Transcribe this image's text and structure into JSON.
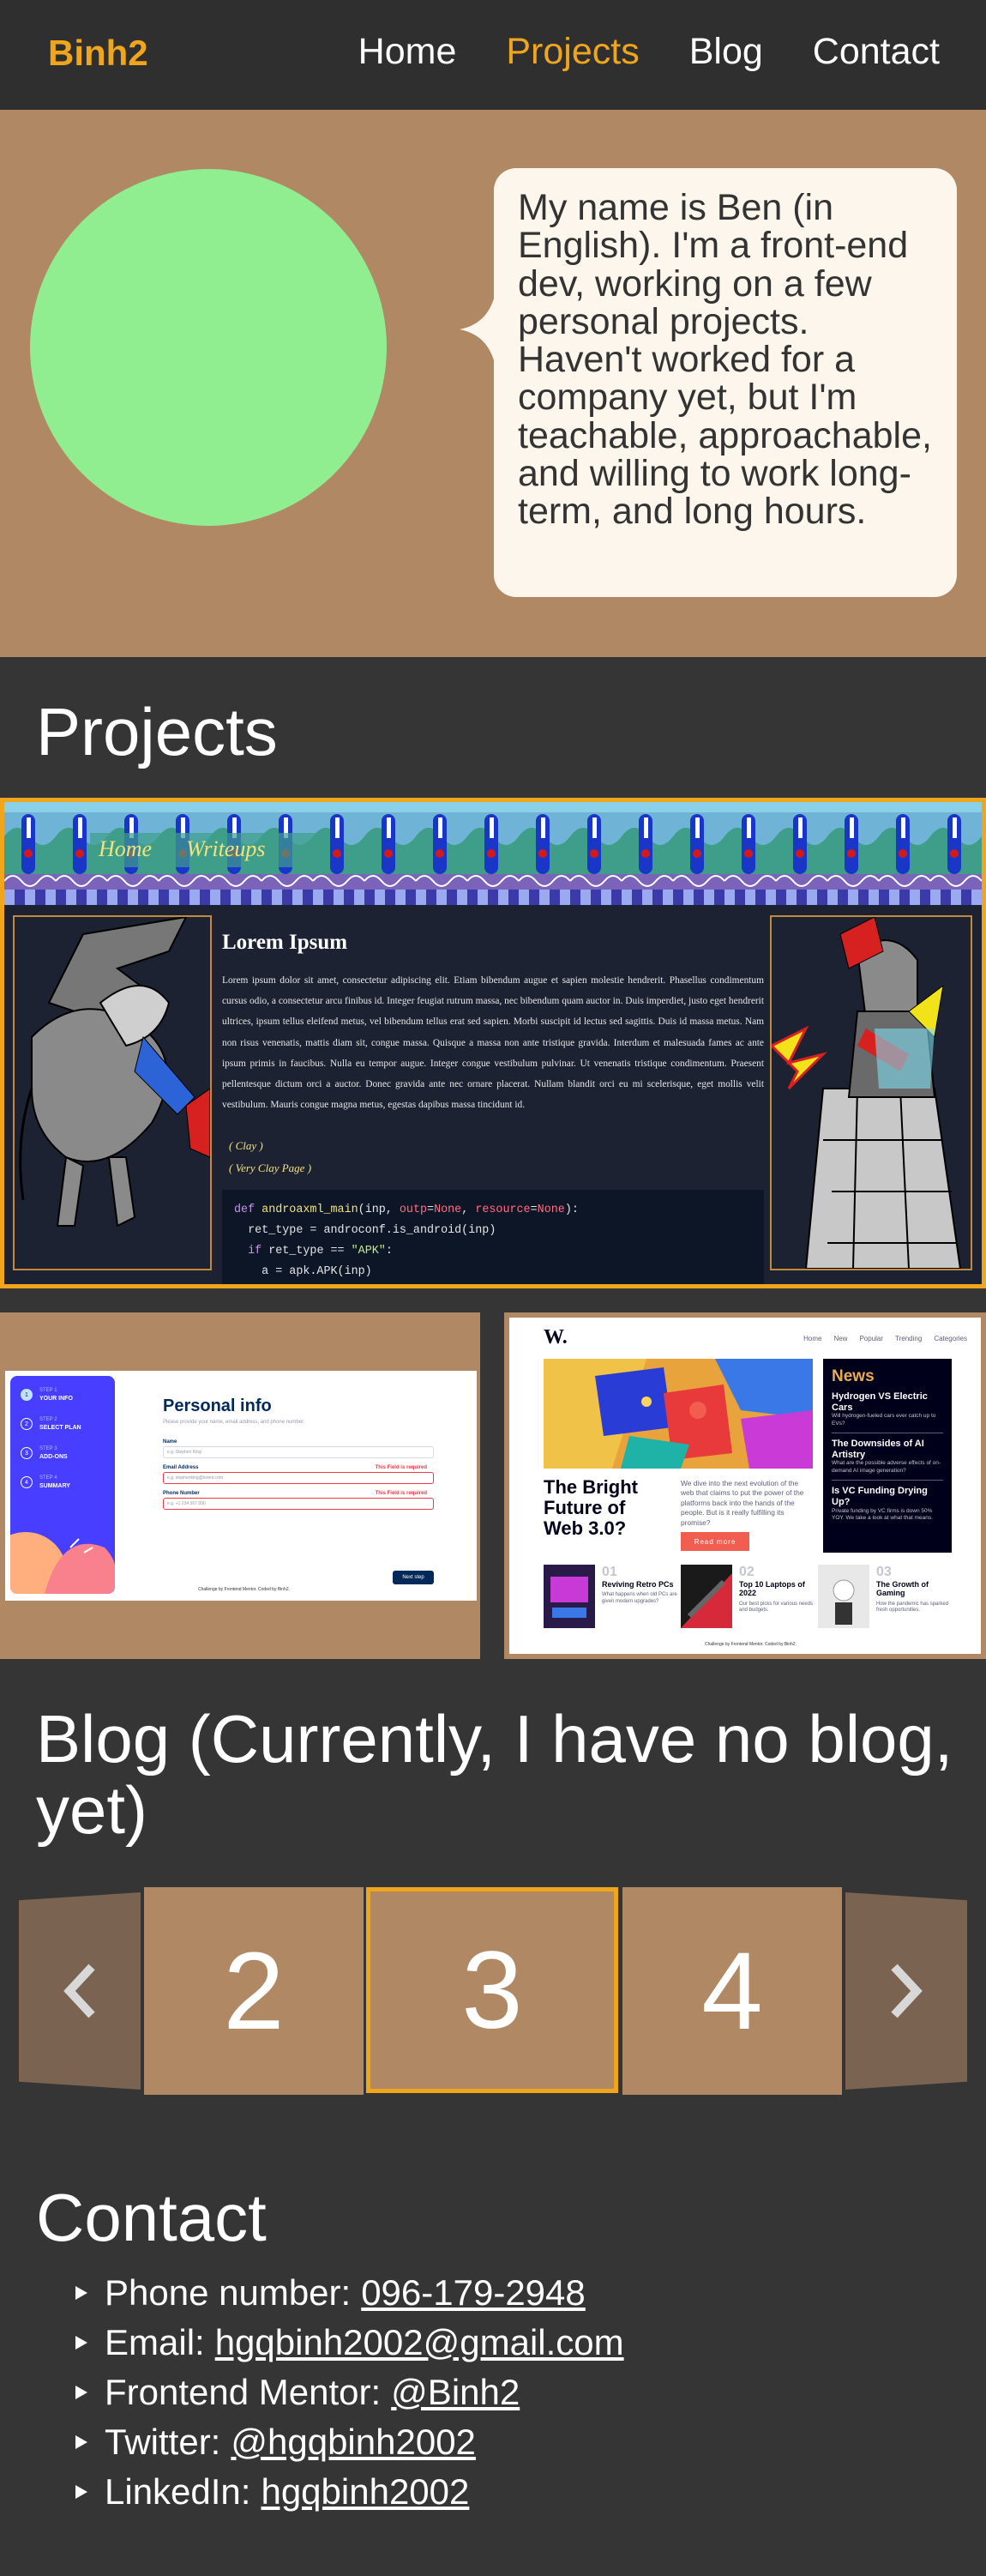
{
  "nav": {
    "brand": "Binh2",
    "links": [
      {
        "label": "Home",
        "active": false
      },
      {
        "label": "Projects",
        "active": true
      },
      {
        "label": "Blog",
        "active": false
      },
      {
        "label": "Contact",
        "active": false
      }
    ]
  },
  "hero": {
    "bio": "My name is Ben (in English). I'm a front-end dev, working on a few personal projects. Haven't worked for a company yet, but I'm teachable, approachable, and willing to work long-term, and long hours."
  },
  "projects": {
    "title": "Projects",
    "project1": {
      "nav": [
        "Home",
        "Writeups"
      ],
      "heading": "Lorem Ipsum",
      "body": "Lorem ipsum dolor sit amet, consectetur adipiscing elit. Etiam bibendum augue et sapien molestie hendrerit. Phasellus condimentum cursus odio, a consectetur arcu finibus id. Integer feugiat rutrum massa, nec bibendum quam auctor in. Duis imperdiet, justo eget hendrerit ultrices, ipsum tellus eleifend metus, vel bibendum tellus erat sed sapien. Morbi suscipit id lectus sed sagittis. Duis id massa metus. Nam non risus venenatis, mattis diam sit, congue massa. Quisque a massa non ante tristique gravida. Interdum et malesuada fames ac ante ipsum primis in faucibus. Nulla eu tempor augue. Integer congue vestibulum pulvinar. Ut venenatis tristique condimentum. Praesent pellentesque dictum orci a auctor. Donec gravida ante nec ornare placerat. Nullam blandit orci eu mi scelerisque, eget mollis velit vestibulum. Mauris congue magna metus, egestas dapibus massa tincidunt id.",
      "links": [
        "( Clay )",
        "( Very Clay Page )"
      ]
    },
    "project2": {
      "steps": [
        {
          "num": "1",
          "label": "STEP 1",
          "name": "YOUR INFO"
        },
        {
          "num": "2",
          "label": "STEP 2",
          "name": "SELECT PLAN"
        },
        {
          "num": "3",
          "label": "STEP 3",
          "name": "ADD-ONS"
        },
        {
          "num": "4",
          "label": "STEP 4",
          "name": "SUMMARY"
        }
      ],
      "heading": "Personal info",
      "subheading": "Please provide your name, email address, and phone number.",
      "fields": [
        {
          "label": "Name",
          "placeholder": "e.g. Stephen King",
          "error": ""
        },
        {
          "label": "Email Address",
          "placeholder": "e.g. stephenking@lorem.com",
          "error": "This Field is required"
        },
        {
          "label": "Phone Number",
          "placeholder": "e.g. +1 234 567 890",
          "error": "This Field is required"
        }
      ],
      "button": "Next step",
      "attribution": "Challenge by Frontend Mentor. Coded by Binh2."
    },
    "project3": {
      "logo": "W.",
      "menu": [
        "Home",
        "New",
        "Popular",
        "Trending",
        "Categories"
      ],
      "headline": "The Bright Future of Web 3.0?",
      "intro": "We dive into the next evolution of the web that claims to put the power of the platforms back into the hands of the people. But is it really fulfilling its promise?",
      "cta": "Read more",
      "news_title": "News",
      "news": [
        {
          "title": "Hydrogen VS Electric Cars",
          "text": "Will hydrogen-fueled cars ever catch up to EVs?"
        },
        {
          "title": "The Downsides of AI Artistry",
          "text": "What are the possible adverse effects of on-demand AI image generation?"
        },
        {
          "title": "Is VC Funding Drying Up?",
          "text": "Private funding by VC firms is down 50% YOY. We take a look at what that means."
        }
      ],
      "bottom": [
        {
          "num": "01",
          "title": "Reviving Retro PCs",
          "text": "What happens when old PCs are given modern upgrades?"
        },
        {
          "num": "02",
          "title": "Top 10 Laptops of 2022",
          "text": "Our best picks for various needs and budgets."
        },
        {
          "num": "03",
          "title": "The Growth of Gaming",
          "text": "How the pandemic has sparked fresh opportunities."
        }
      ],
      "attribution": "Challenge by Frontend Mentor. Coded by Binh2."
    }
  },
  "blog": {
    "title": "Blog (Currently, I have no blog, yet)",
    "cards": [
      "2",
      "3",
      "4"
    ],
    "active_card": "3"
  },
  "contact": {
    "title": "Contact",
    "items": [
      {
        "label": "Phone number:",
        "value": "096-179-2948"
      },
      {
        "label": "Email:",
        "value": "hgqbinh2002@gmail.com"
      },
      {
        "label": "Frontend Mentor:",
        "value": "@Binh2"
      },
      {
        "label": "Twitter:",
        "value": "@hgqbinh2002"
      },
      {
        "label": "LinkedIn:",
        "value": "hgqbinh2002"
      }
    ]
  },
  "colors": {
    "accent": "#f0a61c",
    "page_bg": "#353535",
    "nav_bg": "#2f2f2f",
    "tan": "#b08864",
    "avatar": "#90ee90"
  }
}
